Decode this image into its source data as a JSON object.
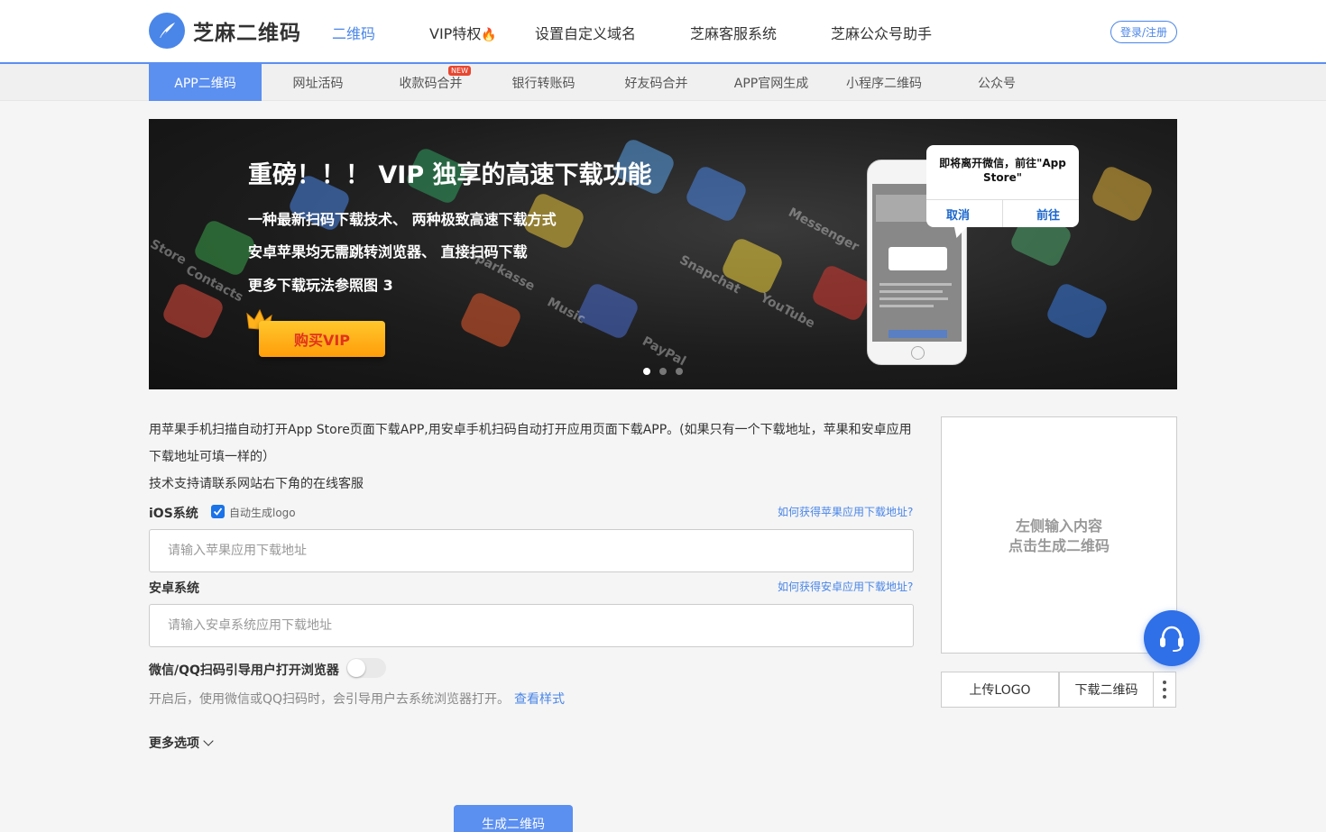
{
  "header": {
    "logo_text": "芝麻二维码",
    "nav": [
      "二维码",
      "VIP特权",
      "设置自定义域名",
      "芝麻客服系统",
      "芝麻公众号助手"
    ],
    "login": "登录/注册"
  },
  "subtabs": {
    "items": [
      "APP二维码",
      "网址活码",
      "收款码合并",
      "银行转账码",
      "好友码合并",
      "APP官网生成",
      "小程序二维码",
      "公众号"
    ],
    "new_badge": "NEW"
  },
  "banner": {
    "title": "重磅！！！ VIP 独享的高速下载功能",
    "lines": [
      "一种最新扫码下载技术、 两种极致高速下载方式",
      "安卓苹果均无需跳转浏览器、 直接扫码下载",
      "更多下载玩法参照图 3"
    ],
    "buy_label": "购买VIP",
    "dialog_message": "即将离开微信，前往\"App Store\"",
    "dialog_cancel": "取消",
    "dialog_go": "前往",
    "app_labels": [
      "Contacts",
      "Music",
      "Snapchat",
      "YouTube",
      "Sparkasse",
      "PayPal",
      "Messenger",
      "Store"
    ],
    "slide_count": 3,
    "active_slide": 1
  },
  "form": {
    "desc1": "用苹果手机扫描自动打开App Store页面下载APP,用安卓手机扫码自动打开应用页面下载APP。(如果只有一个下载地址，苹果和安卓应用",
    "desc2": "下载地址可填一样的）",
    "desc3": "技术支持请联系网站右下角的在线客服",
    "ios_label": "iOS系统",
    "auto_logo": "自动生成logo",
    "auto_logo_checked": true,
    "ios_help": "如何获得苹果应用下载地址?",
    "ios_placeholder": "请输入苹果应用下载地址",
    "android_label": "安卓系统",
    "android_help": "如何获得安卓应用下载地址?",
    "android_placeholder": "请输入安卓系统应用下载地址",
    "wechat_label": "微信/QQ扫码引导用户打开浏览器",
    "wechat_toggle_on": false,
    "hint": "开启后，使用微信或QQ扫码时，会引导用户去系统浏览器打开。",
    "hint_link": "查看样式",
    "more_options": "更多选项",
    "generate": "生成二维码"
  },
  "panel": {
    "placeholder_line1": "左侧输入内容",
    "placeholder_line2": "点击生成二维码",
    "upload_logo": "上传LOGO",
    "download_qr": "下载二维码"
  },
  "colors": {
    "accent": "#4a86e8",
    "tab_active": "#5b8ff0",
    "support_button": "#2f6fe8",
    "buy_vip": "#ffb21c"
  }
}
